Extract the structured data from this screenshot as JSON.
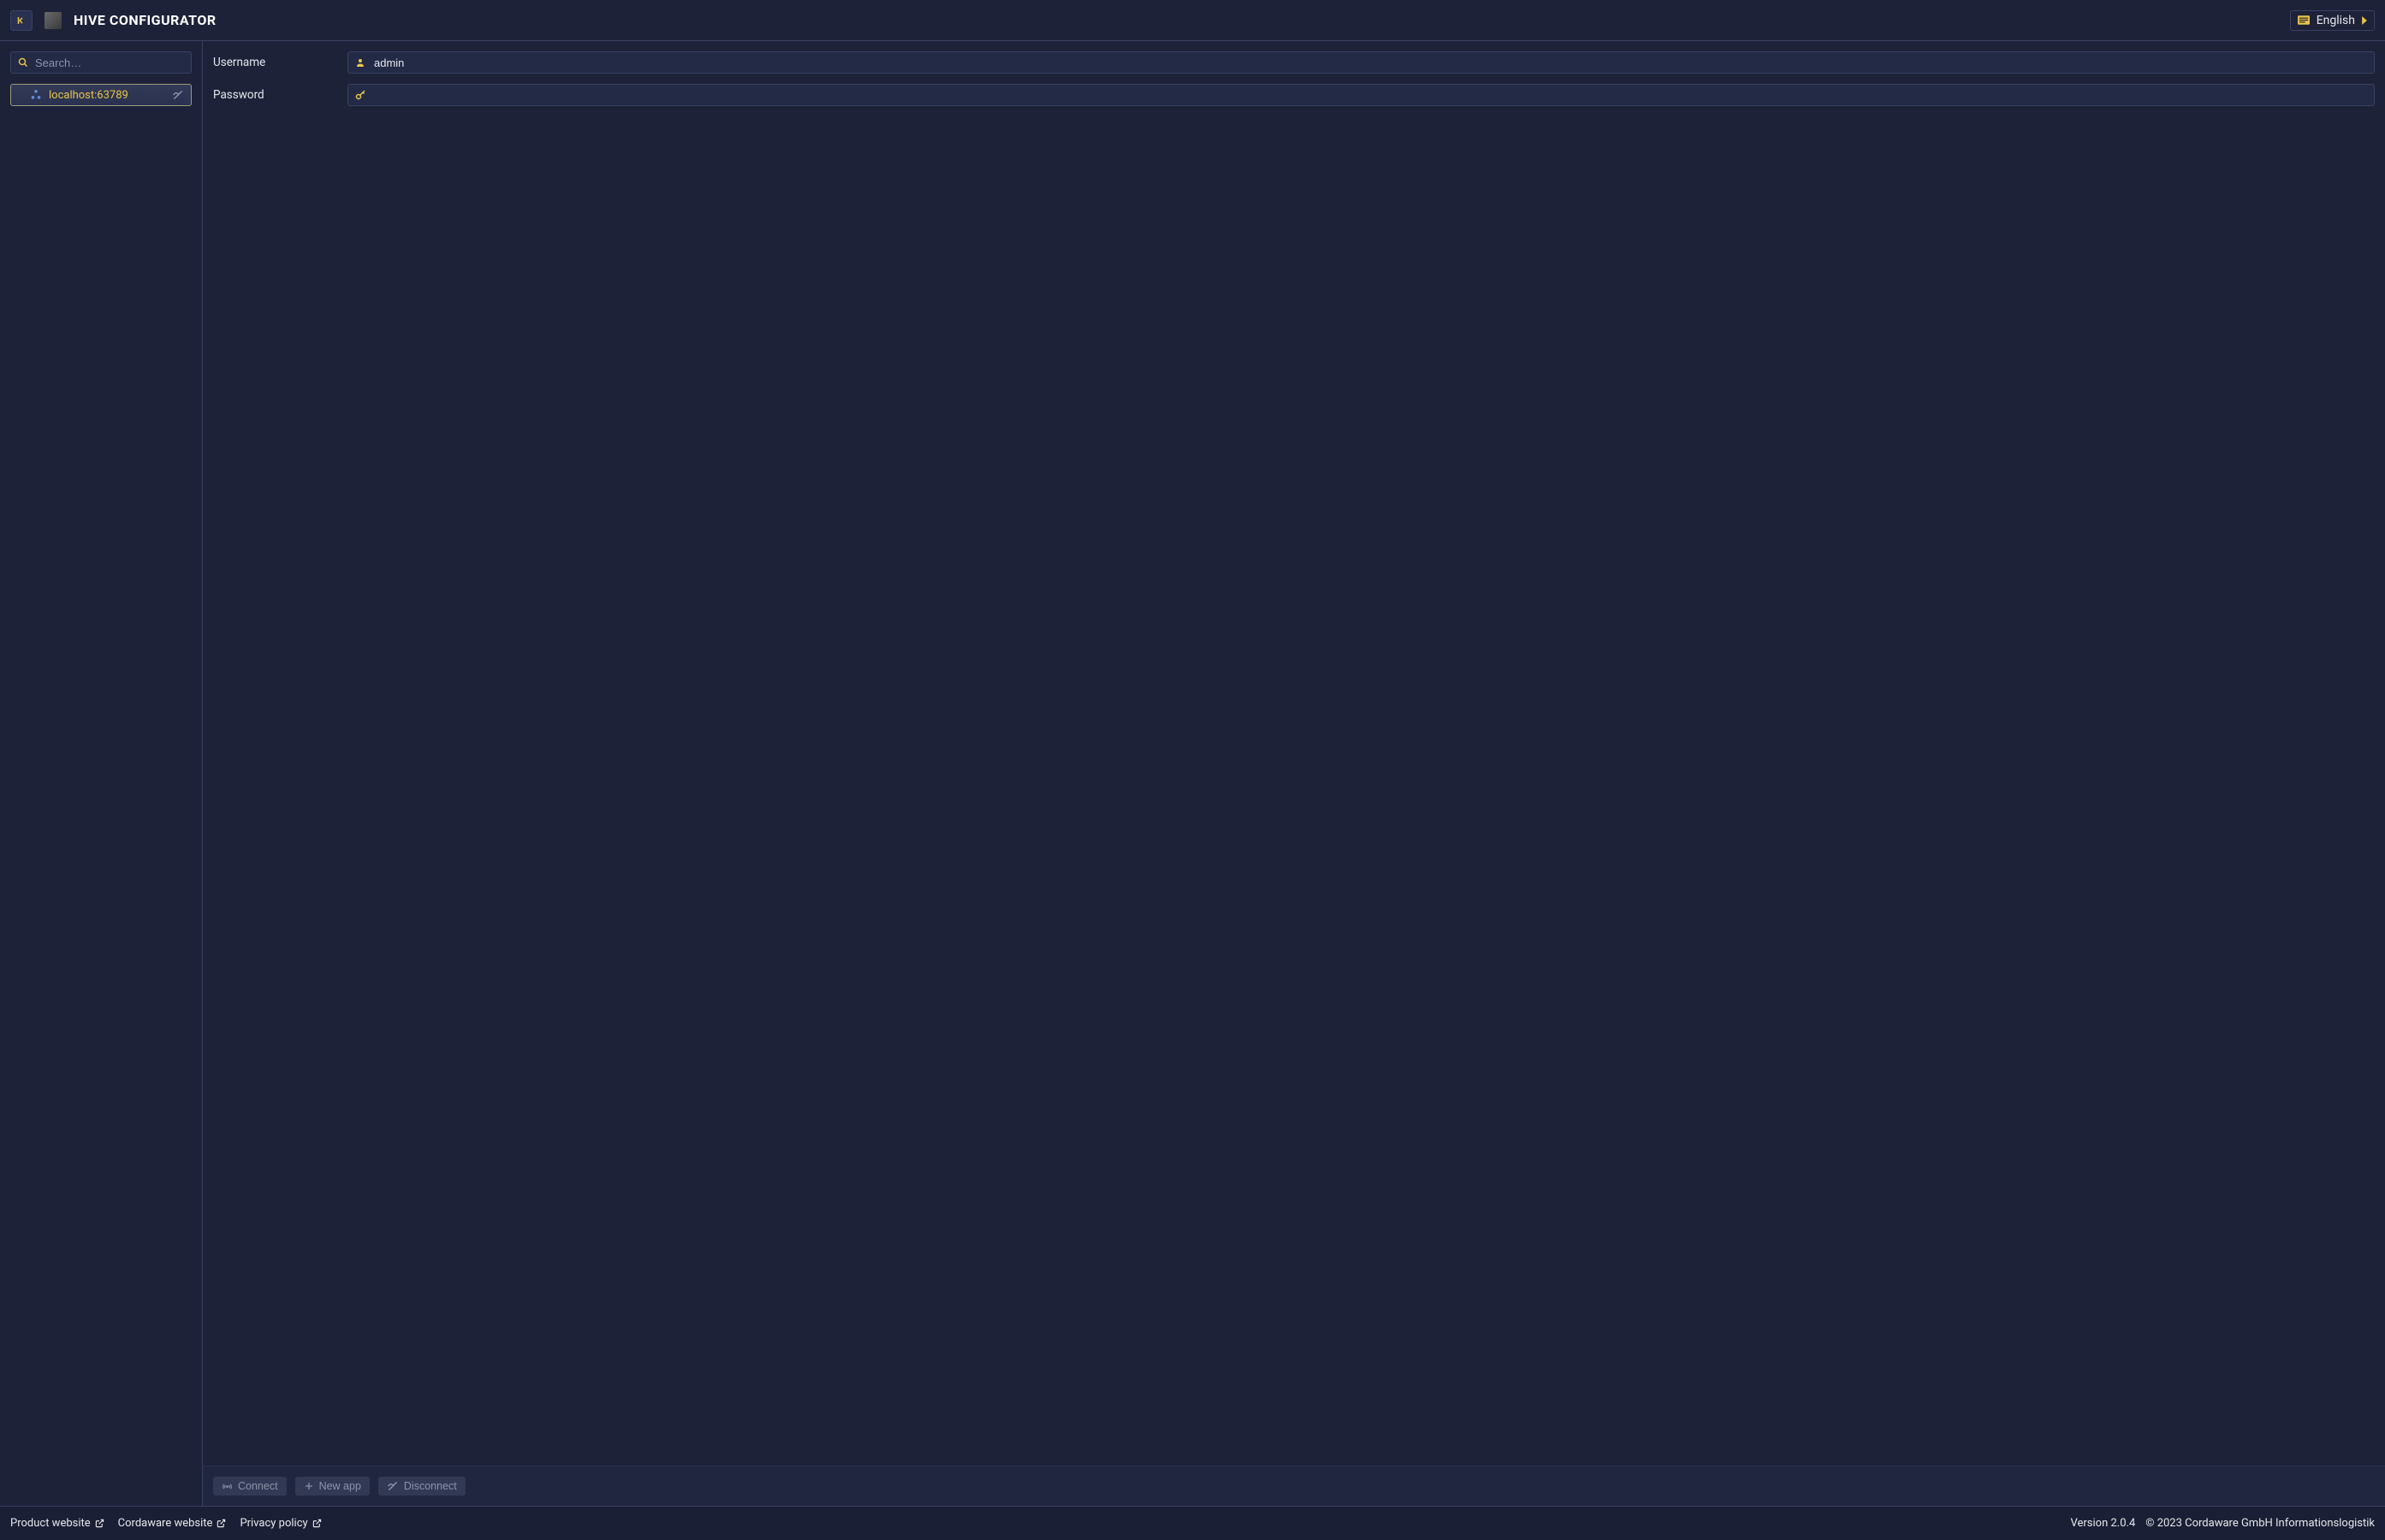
{
  "header": {
    "title": "HIVE CONFIGURATOR",
    "language_label": "English"
  },
  "sidebar": {
    "search_placeholder": "Search…",
    "items": [
      {
        "label": "localhost:63789"
      }
    ]
  },
  "form": {
    "username_label": "Username",
    "username_value": "admin",
    "password_label": "Password",
    "password_value": ""
  },
  "actions": {
    "connect": "Connect",
    "new_app": "New app",
    "disconnect": "Disconnect"
  },
  "footer": {
    "product_website": "Product website",
    "cordaware_website": "Cordaware website",
    "privacy_policy": "Privacy policy",
    "version": "Version 2.0.4",
    "copyright": "© 2023 Cordaware GmbH Informationslogistik"
  }
}
